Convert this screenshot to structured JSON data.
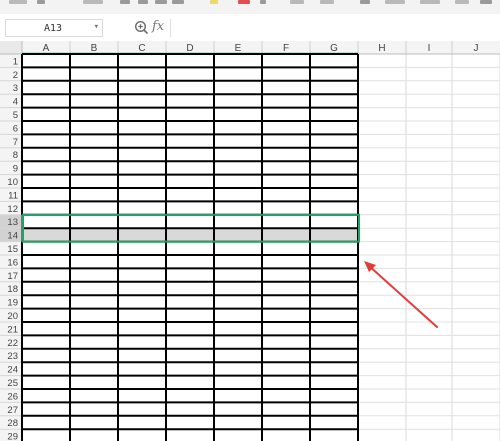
{
  "app": {
    "window": "spreadsheet"
  },
  "formula_bar": {
    "name_box_value": "A13",
    "zoom_icon": "zoom-in-icon",
    "fx_label": "fx",
    "formula_value": ""
  },
  "sheet": {
    "columns": [
      "A",
      "B",
      "C",
      "D",
      "E",
      "F",
      "G",
      "H",
      "I",
      "J"
    ],
    "rows": [
      "1",
      "2",
      "3",
      "4",
      "5",
      "6",
      "7",
      "8",
      "9",
      "10",
      "11",
      "12",
      "13",
      "14",
      "15",
      "16",
      "17",
      "18",
      "19",
      "20",
      "21",
      "22",
      "23",
      "24",
      "25",
      "26",
      "27",
      "28",
      "29"
    ],
    "bordered_columns": [
      "A",
      "B",
      "C",
      "D",
      "E",
      "F",
      "G"
    ],
    "selected_rows": [
      "13",
      "14"
    ],
    "highlighted_fill_row": "14",
    "selection_color": "#21a366",
    "highlight_fill": "#d9d9d9",
    "annotation": {
      "type": "arrow",
      "color": "#e03c3c"
    }
  }
}
